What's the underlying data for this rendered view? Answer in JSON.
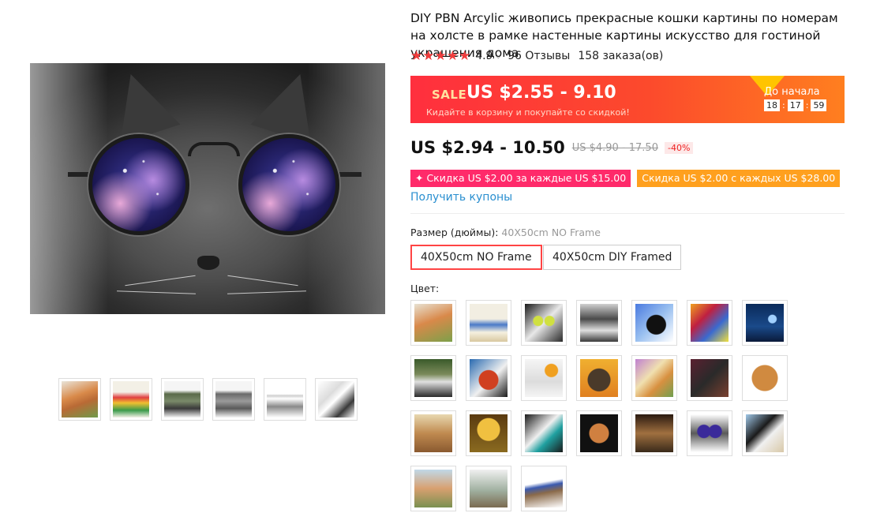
{
  "product": {
    "title": "DIY PBN Arcylic живопись прекрасные кошки картины по номерам на холсте в рамке настенные картины искусство для гостиной украшения дома",
    "stars": "★★★★★",
    "rating": "4.9",
    "reviews": "96 Отзывы",
    "orders": "158 заказа(ов)"
  },
  "sale": {
    "label": "SALE",
    "price": "US $2.55 - 9.10",
    "subtitle": "Кидайте в корзину и покупайте со скидкой!",
    "countdown_label": "До начала",
    "hours": "18",
    "minutes": "17",
    "seconds": "59"
  },
  "pricing": {
    "price": "US $2.94 - 10.50",
    "old_price": "US $4.90 - 17.50",
    "discount": "-40%"
  },
  "coupons": {
    "first": "✦ Скидка US $2.00 за каждые US $15.00",
    "second": "Скидка US $2.00 с каждых US $28.00",
    "get_label": "Получить купоны"
  },
  "size": {
    "label": "Размер (дюймы):",
    "selected": "40X50cm NO Frame",
    "options": [
      "40X50cm NO Frame",
      "40X50cm DIY Framed"
    ]
  },
  "color": {
    "label": "Цвет:"
  },
  "colors": {
    "sale_gradient_start": "#ff2f3e",
    "sale_gradient_end": "#ff7f1f",
    "coupon_pink": "#ff2a6a",
    "coupon_orange": "#ffa01e",
    "link_blue": "#2a8fd0",
    "active_border": "#ff4444"
  }
}
